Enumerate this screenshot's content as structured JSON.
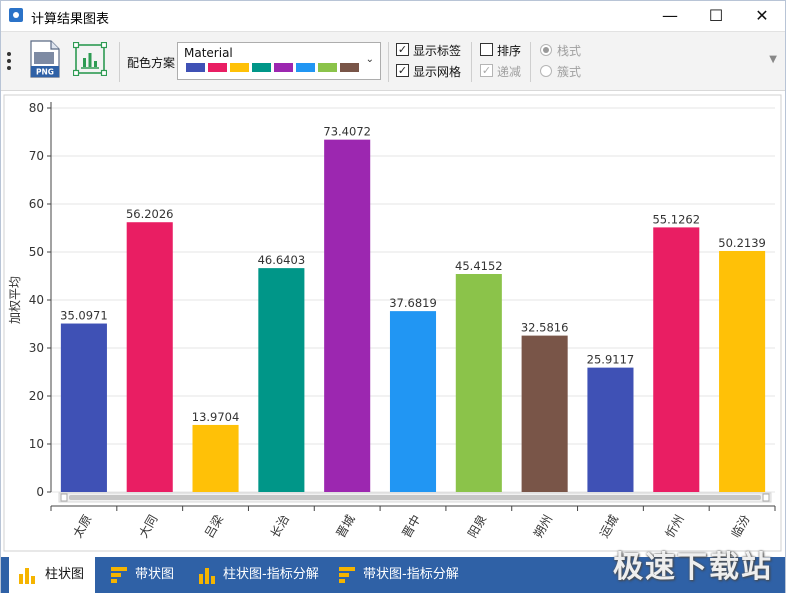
{
  "window": {
    "title": "计算结果图表"
  },
  "toolbar": {
    "scheme_label": "配色方案",
    "scheme_value": "Material",
    "scheme_swatches": [
      "#3f51b5",
      "#e91e63",
      "#ffc107",
      "#009688",
      "#9c27b0",
      "#2196f3",
      "#8bc34a",
      "#795548"
    ],
    "show_labels": "显示标签",
    "show_grid": "显示网格",
    "sort": "排序",
    "descending": "递减",
    "stacked": "栈式",
    "clustered": "簇式",
    "show_labels_checked": true,
    "show_grid_checked": true,
    "sort_checked": false,
    "descending_checked": true
  },
  "chart_data": {
    "type": "bar",
    "ylabel": "加权平均",
    "ylim": [
      0,
      80
    ],
    "yticks": [
      "0",
      "10",
      "20",
      "30",
      "40",
      "50",
      "60",
      "70",
      "80"
    ],
    "categories": [
      "太原",
      "大同",
      "吕梁",
      "长治",
      "晋城",
      "晋中",
      "阳泉",
      "朔州",
      "运城",
      "忻州",
      "临汾"
    ],
    "values": [
      35.0971,
      56.2026,
      13.9704,
      46.6403,
      73.4072,
      37.6819,
      45.4152,
      32.5816,
      25.9117,
      55.1262,
      50.2139
    ],
    "value_labels": [
      "35.0971",
      "56.2026",
      "13.9704",
      "46.6403",
      "73.4072",
      "37.6819",
      "45.4152",
      "32.5816",
      "25.9117",
      "55.1262",
      "50.2139"
    ],
    "colors": [
      "#3f51b5",
      "#e91e63",
      "#ffc107",
      "#009688",
      "#9c27b0",
      "#2196f3",
      "#8bc34a",
      "#795548",
      "#3f51b5",
      "#e91e63",
      "#ffc107"
    ],
    "grid": true
  },
  "tabs": [
    {
      "label": "柱状图",
      "active": true
    },
    {
      "label": "带状图",
      "active": false
    },
    {
      "label": "柱状图-指标分解",
      "active": false
    },
    {
      "label": "带状图-指标分解",
      "active": false
    }
  ],
  "watermark": "极速下载站"
}
